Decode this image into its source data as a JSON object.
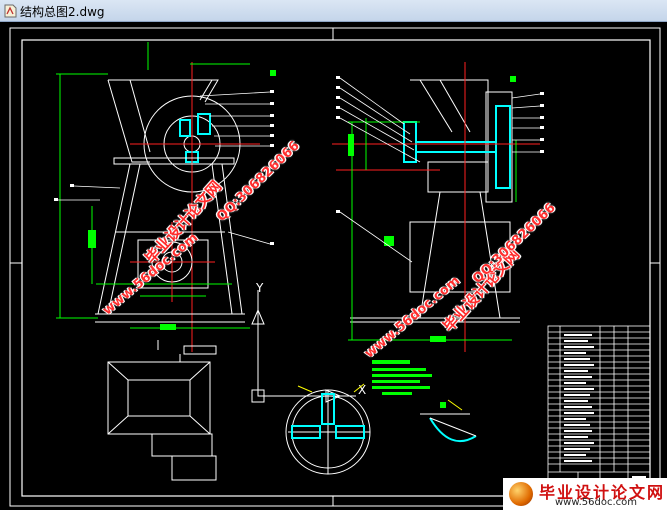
{
  "window": {
    "title": "结构总图2.dwg",
    "file_icon": "dwg-file-icon"
  },
  "watermarks": {
    "site_cn": "毕业设计论文网",
    "site_url": "www.56doc.com",
    "qq": "QQ:306826066"
  },
  "logo": {
    "text": "毕业设计论文网",
    "url": "www.56doc.com"
  },
  "drawing": {
    "axis_y_label": "Y",
    "axis_x_label": "X"
  },
  "colors": {
    "background": "#000000",
    "line_white": "#ffffff",
    "line_green": "#00ff00",
    "line_cyan": "#00ffff",
    "line_red": "#ff2020",
    "line_yellow": "#ffff00"
  }
}
